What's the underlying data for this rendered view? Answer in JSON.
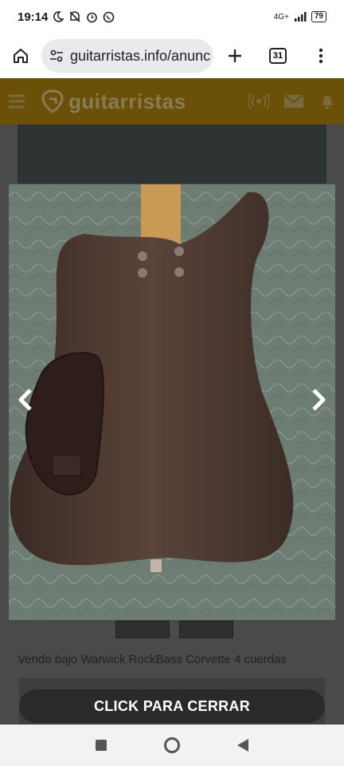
{
  "status_bar": {
    "time": "19:14",
    "network": "4G+",
    "battery": "79",
    "icons_left": [
      "moon-icon",
      "mute-icon",
      "alarm-icon",
      "whatsapp-icon"
    ],
    "icons_right": [
      "signal-icon",
      "battery-icon"
    ]
  },
  "browser": {
    "url": "guitarristas.info/anunc",
    "tab_count": "31",
    "icons": [
      "home-icon",
      "site-settings-icon",
      "new-tab-icon",
      "tabs-icon",
      "menu-icon"
    ]
  },
  "site": {
    "logo_text": "guitarristas",
    "header_icons": [
      "hamburger-menu-icon",
      "broadcast-icon",
      "mail-icon",
      "bell-icon"
    ]
  },
  "gallery": {
    "prev_icon": "chevron-left-icon",
    "next_icon": "chevron-right-icon",
    "photo_label": "Warwick RockBass Corvette bass body, back view",
    "thumbnail_count": 2
  },
  "listing": {
    "title": "Vendo bajo Warwick RockBass Corvette 4 cuerdas"
  },
  "overlay": {
    "close_label": "CLICK PARA CERRAR"
  },
  "system_nav": [
    "recents-square-icon",
    "home-circle-icon",
    "back-triangle-icon"
  ]
}
